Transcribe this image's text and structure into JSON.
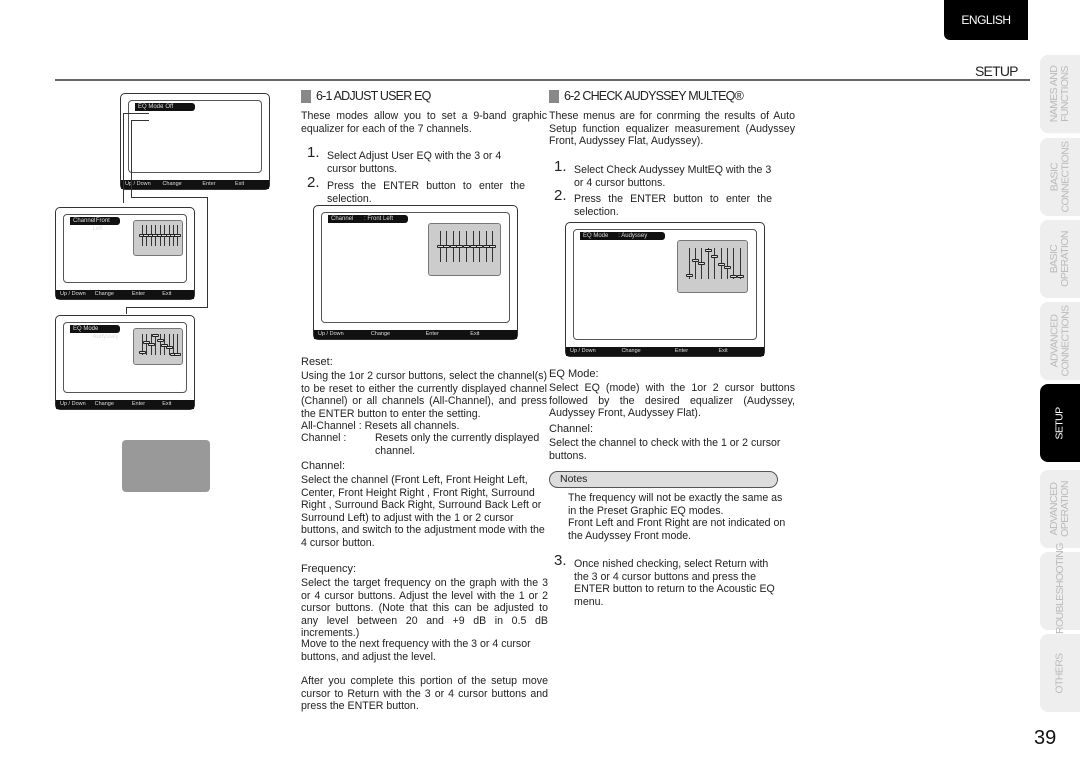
{
  "header": {
    "language": "ENGLISH",
    "section": "SETUP",
    "page_number": "39"
  },
  "side_tabs": [
    {
      "label": "NAMES AND\nFUNCTIONS",
      "active": false
    },
    {
      "label": "BASIC\nCONNECTIONS",
      "active": false
    },
    {
      "label": "BASIC\nOPERATION",
      "active": false
    },
    {
      "label": "ADVANCED\nCONNECTIONS",
      "active": false
    },
    {
      "label": "SETUP",
      "active": true
    },
    {
      "label": "ADVANCED\nOPERATION",
      "active": false
    },
    {
      "label": "TROUBLESHOOTING",
      "active": false
    },
    {
      "label": "OTHERS",
      "active": false
    }
  ],
  "screens": {
    "eq_mode_off": {
      "label": "EQ Mode",
      "value": ": Off"
    },
    "channel": {
      "label": "Channel",
      "value": ": Front Left"
    },
    "eq_mode_audyssey": {
      "label": "EQ Mode",
      "value": ": Audyssey"
    },
    "bar": {
      "updown": "Up / Down",
      "change": "Change",
      "enter": "Enter",
      "exit": "Exit"
    },
    "flat_levels_db": [
      0,
      0,
      0,
      0,
      0,
      0,
      0,
      0,
      0
    ],
    "audyssey_levels_db": [
      -8,
      2,
      0,
      8,
      4,
      -1,
      -3,
      -9,
      -9
    ]
  },
  "s61": {
    "title": "6-1 ADJUST USER EQ",
    "intro": "These modes allow you to set a 9-band graphic equalizer for each of the 7 channels.",
    "step1": "Select  Adjust User EQ  with the 3     or 4 cursor buttons.",
    "step2": "Press the ENTER button to enter the selection.",
    "reset_h": "Reset:",
    "reset": "Using the 1or 2 cursor buttons, select the channel(s) to be reset to either the currently displayed channel (Channel) or all channels (All-Channel), and press the ENTER button to enter the setting.",
    "all_channel": "All-Channel :  Resets all channels.",
    "channel_term": "Channel     :",
    "channel_desc": "Resets only the currently displayed channel.",
    "channel_h": "Channel:",
    "channel": "Select the channel (Front Left, Front Height Left, Center, Front Height Right        , Front Right, Surround Right      , Surround Back Right, Surround Back Left or Surround Left) to adjust with the 1 or 2 cursor buttons, and switch to the adjustment mode with the 4 cursor button.",
    "frequency_h": "Frequency:",
    "frequency": "Select the target frequency on the graph with the 3  or 4 cursor buttons. Adjust the level with the 1 or 2 cursor buttons. (Note that this can be adjusted to any level between   20 and +9 dB in 0.5 dB increments.)",
    "frequency2": "Move to the next frequency with the 3 or 4 cursor buttons, and adjust the level.",
    "after": "After you complete this portion of the setup move cursor to Return with the 3    or 4 cursor buttons and press the ENTER button."
  },
  "s62": {
    "title": "6-2 CHECK AUDYSSEY MULTEQ®",
    "intro": "These menus are for conrming the results of Auto Setup function equalizer measurement (Audyssey Front, Audyssey Flat, Audyssey).",
    "step1": "Select  Check Audyssey MultEQ  with the 3  or 4  cursor buttons.",
    "step2": "Press the ENTER button to enter the selection.",
    "eqmode_h": "EQ Mode:",
    "eqmode": "Select EQ (mode) with the 1or 2 cursor buttons followed by the desired equalizer (Audyssey, Audyssey Front, Audyssey Flat).",
    "channel_h": "Channel:",
    "channel": "Select the channel to check with the 1 or 2 cursor buttons.",
    "notes_h": "Notes",
    "note1": "The frequency will not be exactly the same as in the Preset Graphic EQ modes.",
    "note2": "Front Left and Front Right are not indicated on the Audyssey Front mode.",
    "step3": "Once   nished checking, select    Return  with the 3   or 4  cursor buttons and press the ENTER button to return to the  Acoustic EQ  menu."
  }
}
